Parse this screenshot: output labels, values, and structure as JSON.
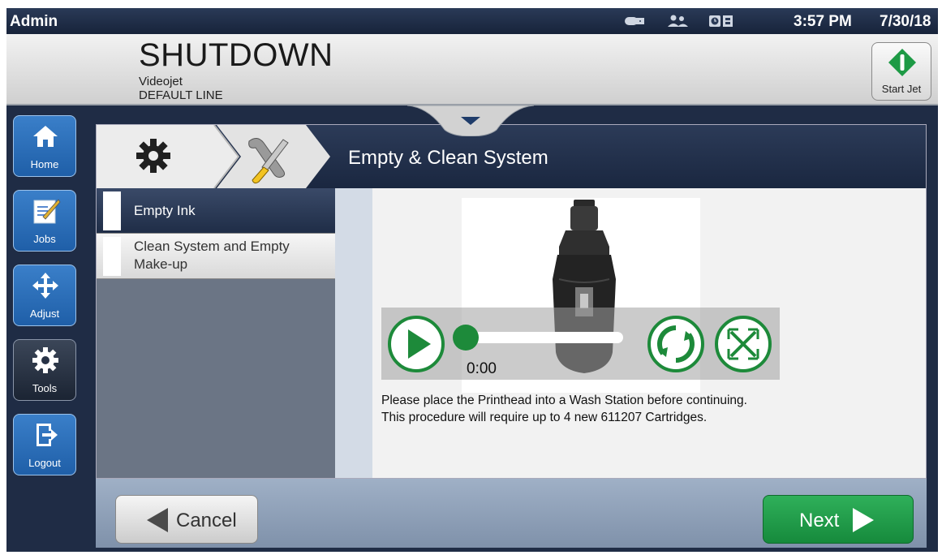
{
  "status_bar": {
    "user": "Admin",
    "time": "3:57 PM",
    "date": "7/30/18"
  },
  "header": {
    "state": "SHUTDOWN",
    "line1": "Videojet",
    "line2": "DEFAULT LINE",
    "start_jet_label": "Start Jet"
  },
  "nav": {
    "home": "Home",
    "jobs": "Jobs",
    "adjust": "Adjust",
    "tools": "Tools",
    "logout": "Logout"
  },
  "panel": {
    "title": "Empty & Clean System",
    "list": [
      {
        "label": "Empty Ink"
      },
      {
        "label_line1": "Clean System and Empty",
        "label_line2": "Make-up"
      }
    ],
    "video_time": "0:00",
    "instructions_line1": "Please place the Printhead into a Wash Station before continuing.",
    "instructions_line2": "This procedure will require up to 4 new 611207 Cartridges."
  },
  "footer": {
    "cancel": "Cancel",
    "next": "Next"
  },
  "colors": {
    "accent_green": "#1d8a3a",
    "nav_blue": "#2b6fbf",
    "dark_navy": "#1f2c45"
  }
}
